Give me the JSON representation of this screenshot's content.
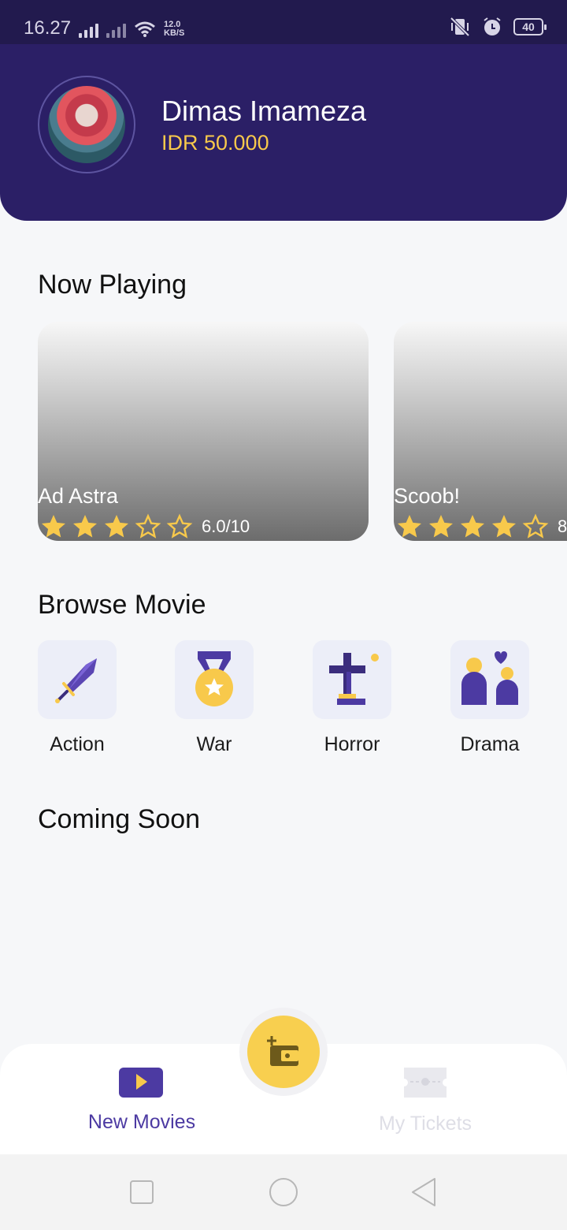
{
  "status_bar": {
    "time": "16.27",
    "net_speed_value": "12.0",
    "net_speed_unit": "KB/S",
    "battery": "40"
  },
  "profile": {
    "name": "Dimas Imameza",
    "balance": "IDR 50.000"
  },
  "sections": {
    "now_playing": "Now Playing",
    "browse_movie": "Browse Movie",
    "coming_soon": "Coming Soon"
  },
  "now_playing": [
    {
      "title": "Ad Astra",
      "rating_text": "6.0/10",
      "stars_filled": 3,
      "stars_total": 5
    },
    {
      "title": "Scoob!",
      "rating_text": "8",
      "stars_filled": 4,
      "stars_total": 5
    }
  ],
  "genres": [
    {
      "label": "Action",
      "icon": "sword-icon"
    },
    {
      "label": "War",
      "icon": "medal-icon"
    },
    {
      "label": "Horror",
      "icon": "grave-cross-icon"
    },
    {
      "label": "Drama",
      "icon": "couple-heart-icon"
    }
  ],
  "bottom_nav": {
    "new_movies": "New Movies",
    "my_tickets": "My Tickets",
    "center_action_icon": "wallet-add-icon"
  },
  "colors": {
    "header_bg": "#2b1f66",
    "accent_yellow": "#f8c94b",
    "accent_purple": "#4c3aa2",
    "inactive": "#dedee6"
  }
}
